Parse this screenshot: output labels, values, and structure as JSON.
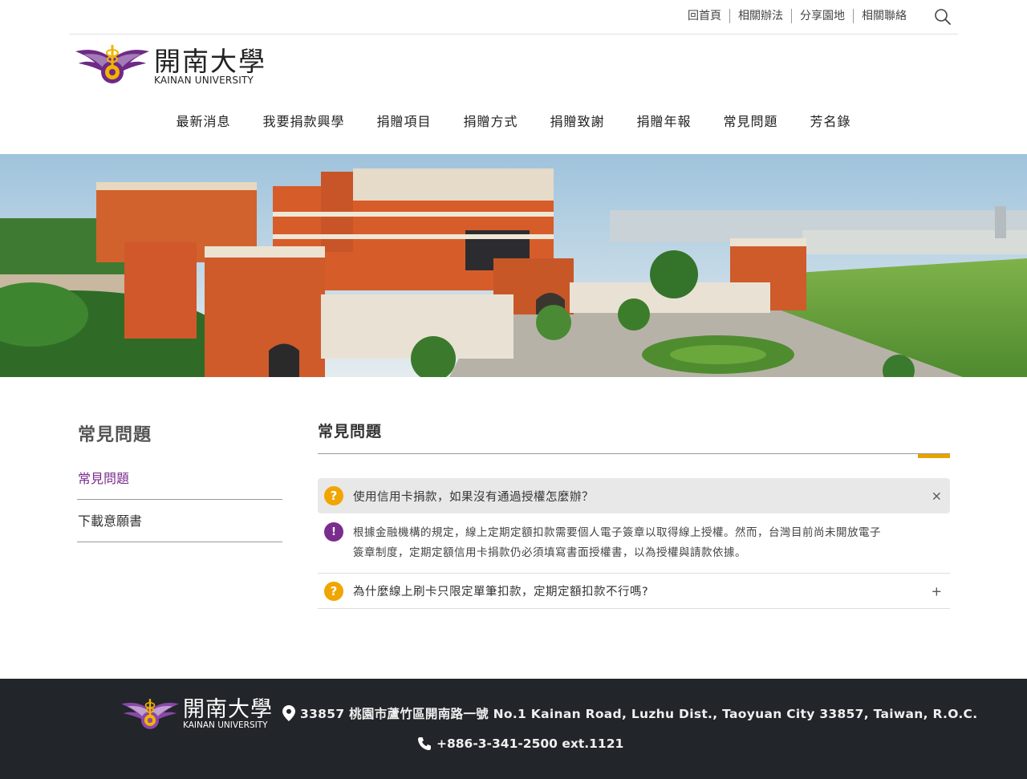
{
  "top_links": [
    "回首頁",
    "相關辦法",
    "分享園地",
    "相關聯絡"
  ],
  "logo": {
    "cn": "開南大學",
    "en": "KAINAN UNIVERSITY"
  },
  "main_nav": [
    "最新消息",
    "我要捐款興學",
    "捐贈項目",
    "捐贈方式",
    "捐贈致謝",
    "捐贈年報",
    "常見問題",
    "芳名錄"
  ],
  "sidebar": {
    "title": "常見問題",
    "items": [
      {
        "label": "常見問題",
        "active": true
      },
      {
        "label": "下載意願書",
        "active": false
      }
    ]
  },
  "content": {
    "title": "常見問題",
    "faq": [
      {
        "q_badge": "?",
        "question": "使用信用卡捐款，如果沒有通過授權怎麼辦？",
        "toggle": "×",
        "open": true,
        "a_badge": "!",
        "answer_line1": "根據金融機構的規定，線上定期定額扣款需要個人電子簽章以取得線上授權。然而，台灣目前尚未開放電子",
        "answer_line2": "簽章制度，定期定額信用卡捐款仍必須填寫書面授權書，以為授權與請款依據。"
      },
      {
        "q_badge": "?",
        "question": "為什麼線上刷卡只限定單筆扣款，定期定額扣款不行嗎?",
        "toggle": "+",
        "open": false
      }
    ]
  },
  "footer": {
    "logo_cn": "開南大學",
    "logo_en": "KAINAN UNIVERSITY",
    "address": "33857 桃園市蘆竹區開南路一號 No.1 Kainan Road, Luzhu Dist., Taoyuan City 33857, Taiwan, R.O.C.",
    "phone": "+886-3-341-2500 ext.1121"
  },
  "colors": {
    "brand_purple": "#7b2d8e",
    "accent_gold": "#e6a400",
    "footer_bg": "#222529"
  },
  "icons": [
    "search-icon",
    "location-pin-icon",
    "phone-icon",
    "university-emblem"
  ]
}
